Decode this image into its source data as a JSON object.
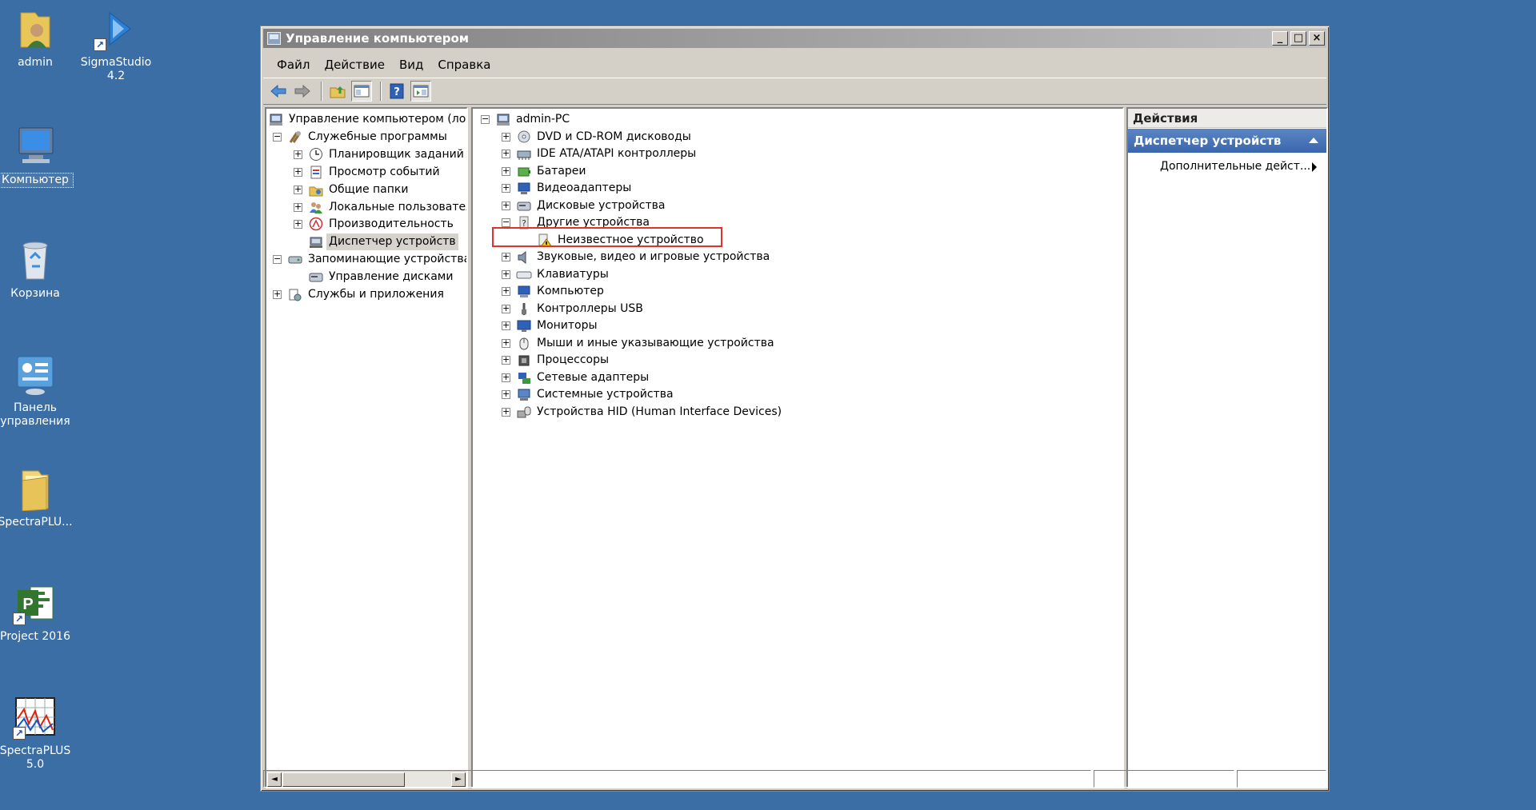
{
  "desktop": {
    "icons": [
      {
        "label": "admin",
        "icon": "user-folder-icon"
      },
      {
        "label": "SigmaStudio 4.2",
        "icon": "sigmastudio-icon"
      },
      {
        "label": "Компьютер",
        "icon": "computer-icon"
      },
      {
        "label": "Корзина",
        "icon": "recycle-bin-icon"
      },
      {
        "label": "Панель управления",
        "icon": "control-panel-icon"
      },
      {
        "label": "SpectraPLU...",
        "icon": "folder-icon"
      },
      {
        "label": "Project 2016",
        "icon": "ms-project-icon"
      },
      {
        "label": "SpectraPLUS 5.0",
        "icon": "spectraplus-icon"
      }
    ]
  },
  "window": {
    "title": "Управление компьютером",
    "controls": {
      "minimize": "_",
      "maximize": "□",
      "close": "×"
    },
    "menu": [
      "Файл",
      "Действие",
      "Вид",
      "Справка"
    ],
    "toolbar": [
      "back-icon",
      "forward-icon",
      "up-folder-icon",
      "show-hide-tree-icon",
      "help-icon",
      "show-hide-action-pane-icon"
    ]
  },
  "left_tree": {
    "items": [
      {
        "label": "Управление компьютером (лока",
        "expander": ""
      },
      {
        "label": "Служебные программы",
        "expander": "−"
      },
      {
        "label": "Планировщик заданий",
        "expander": "+"
      },
      {
        "label": "Просмотр событий",
        "expander": "+"
      },
      {
        "label": "Общие папки",
        "expander": "+"
      },
      {
        "label": "Локальные пользовател",
        "expander": "+"
      },
      {
        "label": "Производительность",
        "expander": "+"
      },
      {
        "label": "Диспетчер устройств",
        "expander": "",
        "selected": true
      },
      {
        "label": "Запоминающие устройства",
        "expander": "−"
      },
      {
        "label": "Управление дисками",
        "expander": ""
      },
      {
        "label": "Службы и приложения",
        "expander": "+"
      }
    ],
    "scroll": {
      "left": "◄",
      "right": "►"
    }
  },
  "device_tree": {
    "root": "admin-PC",
    "categories": [
      {
        "label": "DVD и CD-ROM дисководы",
        "expander": "+"
      },
      {
        "label": "IDE ATA/ATAPI контроллеры",
        "expander": "+"
      },
      {
        "label": "Батареи",
        "expander": "+"
      },
      {
        "label": "Видеоадаптеры",
        "expander": "+"
      },
      {
        "label": "Дисковые устройства",
        "expander": "+"
      },
      {
        "label": "Другие устройства",
        "expander": "−"
      },
      {
        "label": "Неизвестное устройство",
        "expander": "",
        "child": true,
        "warning": true
      },
      {
        "label": "Звуковые, видео и игровые устройства",
        "expander": "+"
      },
      {
        "label": "Клавиатуры",
        "expander": "+"
      },
      {
        "label": "Компьютер",
        "expander": "+"
      },
      {
        "label": "Контроллеры USB",
        "expander": "+"
      },
      {
        "label": "Мониторы",
        "expander": "+"
      },
      {
        "label": "Мыши и иные указывающие устройства",
        "expander": "+"
      },
      {
        "label": "Процессоры",
        "expander": "+"
      },
      {
        "label": "Сетевые адаптеры",
        "expander": "+"
      },
      {
        "label": "Системные устройства",
        "expander": "+"
      },
      {
        "label": "Устройства HID (Human Interface Devices)",
        "expander": "+"
      }
    ]
  },
  "actions": {
    "header": "Действия",
    "section": "Диспетчер устройств",
    "more": "Дополнительные дейст..."
  }
}
